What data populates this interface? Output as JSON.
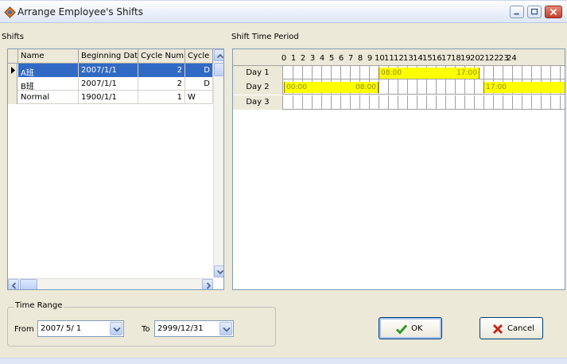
{
  "window": {
    "title": "Arrange Employee's Shifts"
  },
  "shifts": {
    "label": "Shifts",
    "columns": [
      "Name",
      "Beginning Date",
      "Cycle Num",
      "Cycle"
    ],
    "rows": [
      {
        "name": "A班",
        "beginning_date": "2007/1/1",
        "cycle_num": "2",
        "cycle": "D",
        "selected": true
      },
      {
        "name": "B班",
        "beginning_date": "2007/1/1",
        "cycle_num": "2",
        "cycle": "D",
        "selected": false
      },
      {
        "name": "Normal",
        "beginning_date": "1900/1/1",
        "cycle_num": "1",
        "cycle": "W",
        "selected": false
      }
    ]
  },
  "period": {
    "label": "Shift Time Period",
    "hours": [
      "0",
      "1",
      "2",
      "3",
      "4",
      "5",
      "6",
      "7",
      "8",
      "9",
      "10",
      "11",
      "12",
      "13",
      "14",
      "15",
      "16",
      "17",
      "18",
      "19",
      "20",
      "21",
      "22",
      "23",
      "24"
    ],
    "days": [
      {
        "label": "Day 1",
        "bars": [
          {
            "start": "08:00",
            "end": "17:00"
          }
        ]
      },
      {
        "label": "Day 2",
        "bars": [
          {
            "start": "00:00",
            "end": "08:00"
          },
          {
            "start": "17:00",
            "end": ""
          }
        ]
      },
      {
        "label": "Day 3",
        "bars": []
      }
    ],
    "bar_color": "#ffff00"
  },
  "time_range": {
    "label": "Time Range",
    "from_label": "From",
    "from_value": "2007/ 5/ 1",
    "to_label": "To",
    "to_value": "2999/12/31"
  },
  "buttons": {
    "ok_label": "OK",
    "cancel_label": "Cancel"
  },
  "icons": {
    "app": "arrange-shifts-icon",
    "ok": "check-icon",
    "cancel": "x-icon"
  }
}
